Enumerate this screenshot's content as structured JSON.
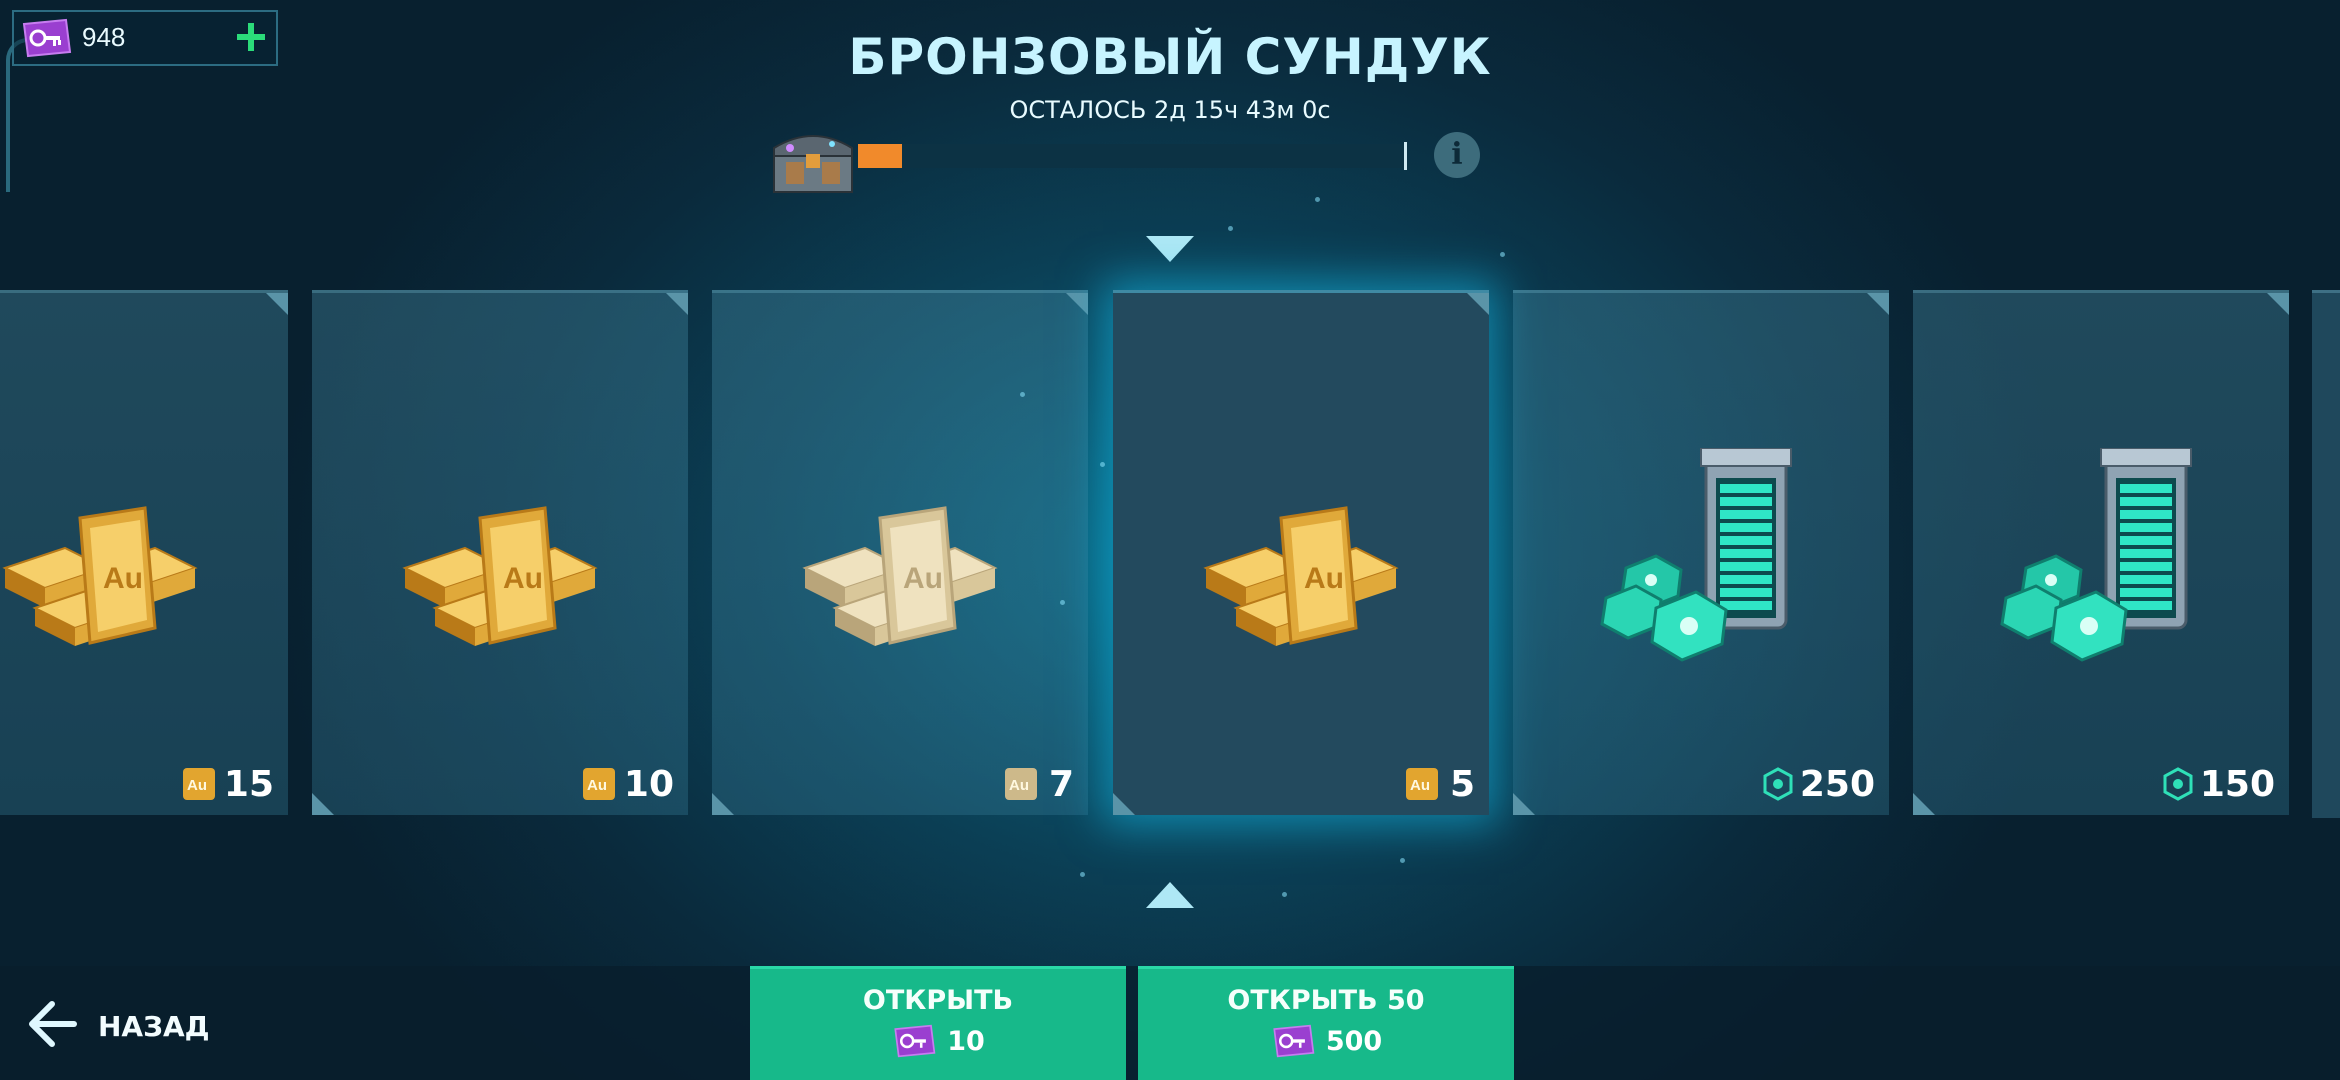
{
  "keys": {
    "value": "948",
    "icon": "key-icon"
  },
  "header": {
    "title": "БРОНЗОВЫЙ СУНДУК",
    "timer": "ОСТАЛОСЬ 2д 15ч 43м 0с",
    "progress_fraction": 0.08
  },
  "cards": [
    {
      "amount": "15",
      "currency": "gold-icon",
      "item": "gold-bars",
      "tint": "gold"
    },
    {
      "amount": "10",
      "currency": "gold-icon",
      "item": "gold-bars",
      "tint": "gold"
    },
    {
      "amount": "7",
      "currency": "gold-icon",
      "item": "gold-bars",
      "tint": "pale"
    },
    {
      "amount": "5",
      "currency": "gold-icon",
      "item": "gold-bars",
      "tint": "gold",
      "active": true
    },
    {
      "amount": "250",
      "currency": "chip-icon",
      "item": "power-cell"
    },
    {
      "amount": "150",
      "currency": "chip-icon",
      "item": "power-cell"
    }
  ],
  "footer": {
    "back_label": "НАЗАД",
    "open_label": "ОТКРЫТЬ",
    "open_cost": "10",
    "open50_label": "ОТКРЫТЬ 50",
    "open50_cost": "500"
  },
  "colors": {
    "accent_green": "#17b98a",
    "progress_orange": "#f18a2b",
    "plus_green": "#2bdc7a"
  }
}
